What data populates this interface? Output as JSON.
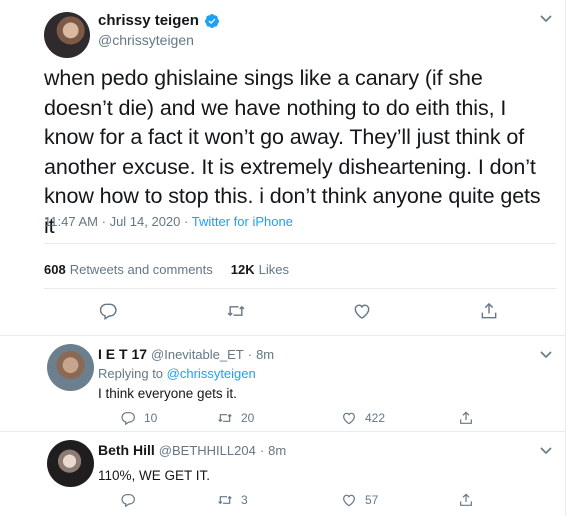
{
  "tweet": {
    "author_name": "chrissy teigen",
    "author_handle": "@chrissyteigen",
    "text": "when pedo ghislaine sings like a canary (if she doesn’t die) and we have nothing to do eith this, I know for a fact it won’t go away. They’ll just think of another excuse. It is extremely disheartening. I don’t know how to stop this. i don’t think anyone quite gets it",
    "time": "11:47 AM",
    "separator": "·",
    "date": "Jul 14, 2020",
    "source": "Twitter for iPhone",
    "retweets_count": "608",
    "retweets_label": "Retweets and comments",
    "likes_count": "12K",
    "likes_label": "Likes"
  },
  "replies": [
    {
      "name": "I E T 17",
      "handle": "@Inevitable_ET",
      "time": "8m",
      "replying_prefix": "Replying to",
      "replying_to": "@chrissyteigen",
      "text": "I think everyone gets it.",
      "reply_count": "10",
      "retweet_count": "20",
      "like_count": "422"
    },
    {
      "name": "Beth Hill",
      "handle": "@BETHHILL204",
      "time": "8m",
      "text": "110%, WE GET IT.",
      "reply_count": "",
      "retweet_count": "3",
      "like_count": "57"
    }
  ],
  "icons": [
    "verified-badge-icon",
    "chevron-down-icon",
    "reply-icon",
    "retweet-icon",
    "like-icon",
    "share-icon"
  ],
  "colors": {
    "accent": "#1da1f2",
    "text": "#14171a",
    "muted": "#657786",
    "border": "#e6ecf0"
  }
}
